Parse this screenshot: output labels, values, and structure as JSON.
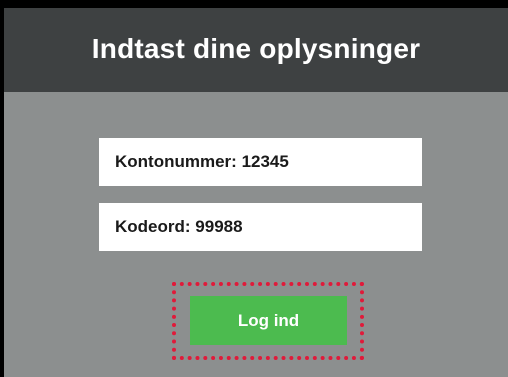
{
  "header": {
    "title": "Indtast dine oplysninger"
  },
  "form": {
    "account": {
      "label": "Kontonummer:",
      "value": "12345"
    },
    "password": {
      "label": "Kodeord:",
      "value": "99988"
    },
    "login_button": "Log ind"
  },
  "colors": {
    "header_bg": "#3e4142",
    "panel_bg": "#8c8f8f",
    "button_bg": "#4cbb4f",
    "highlight": "#e01a3a"
  }
}
